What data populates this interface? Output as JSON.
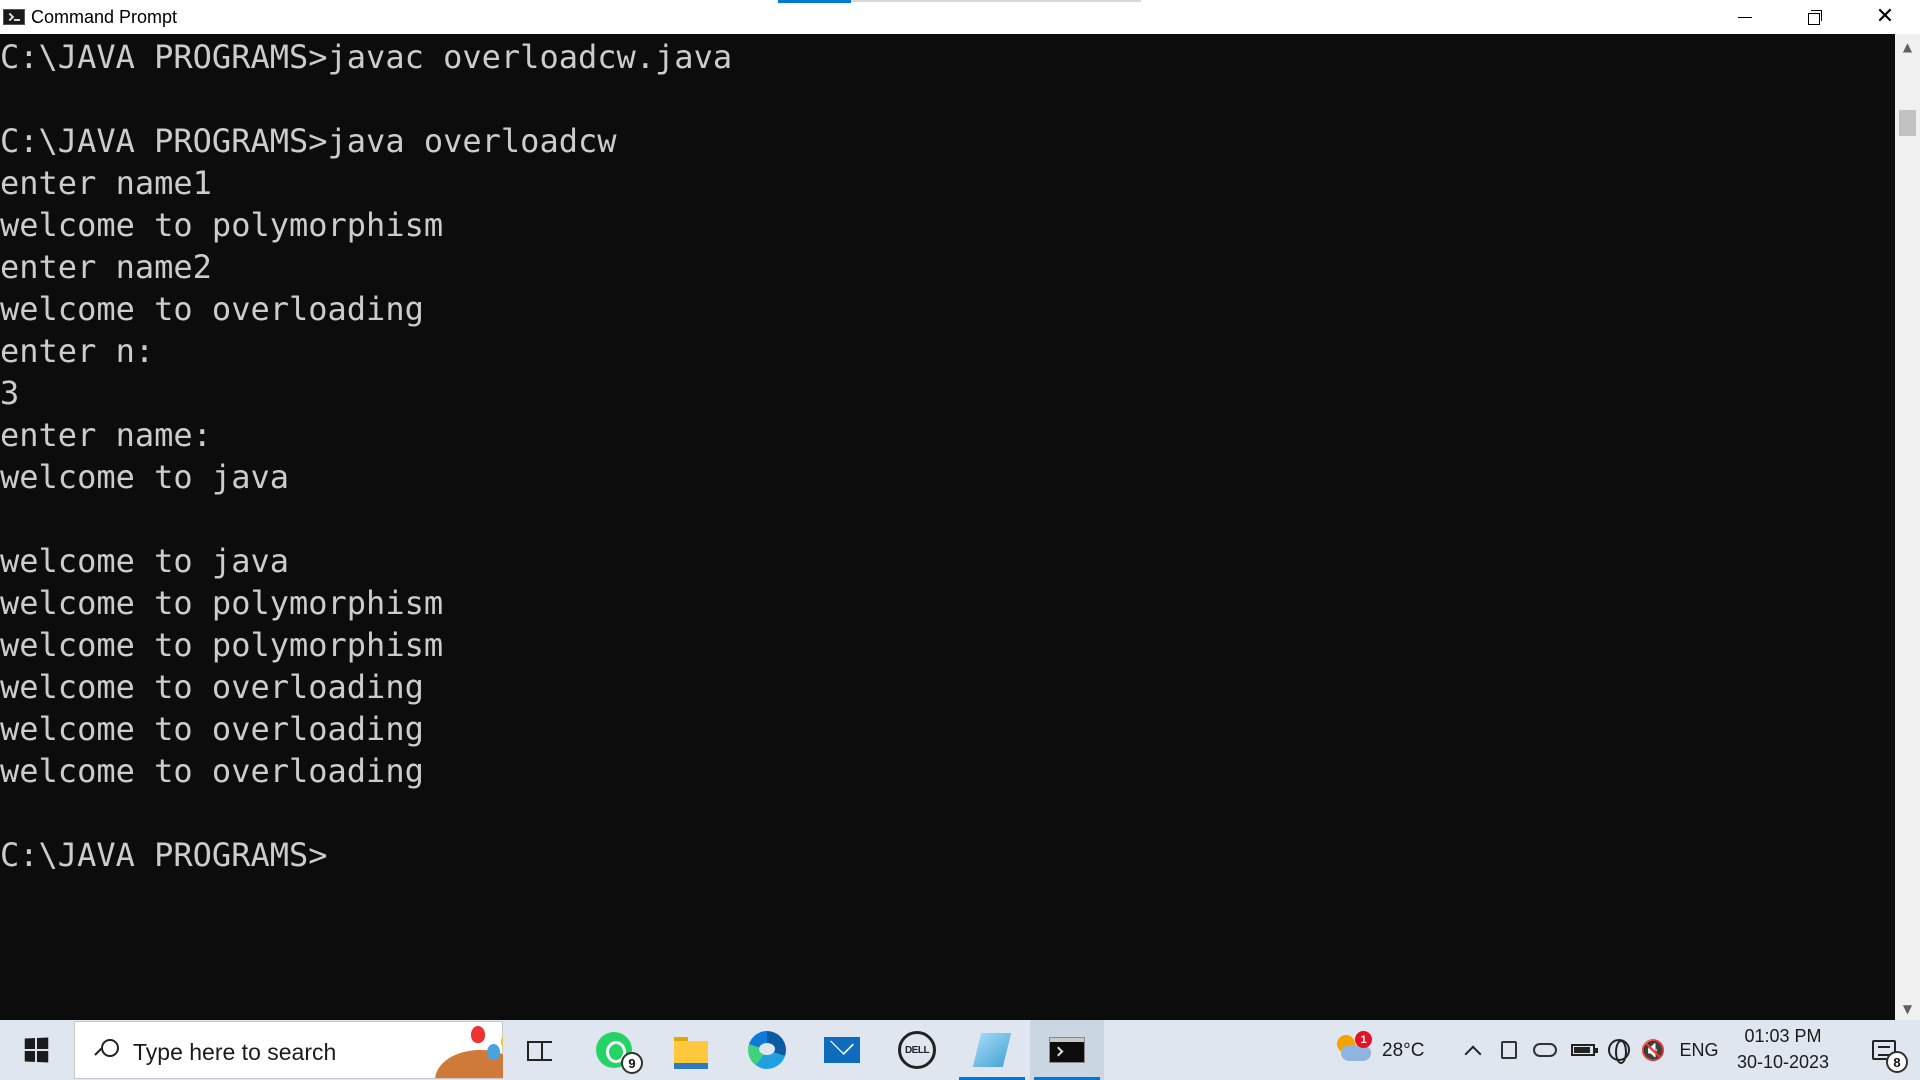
{
  "window": {
    "title": "Command Prompt",
    "controls": {
      "minimize_icon": "minimize-icon",
      "restore_icon": "restore-icon",
      "close_icon": "close-icon"
    }
  },
  "console": {
    "background": "#0c0c0c",
    "foreground": "#cccccc",
    "lines": [
      "C:\\JAVA PROGRAMS>javac overloadcw.java",
      "",
      "C:\\JAVA PROGRAMS>java overloadcw",
      "enter name1",
      "welcome to polymorphism",
      "enter name2",
      "welcome to overloading",
      "enter n:",
      "3",
      "enter name:",
      "welcome to java",
      "",
      "welcome to java",
      "welcome to polymorphism",
      "welcome to polymorphism",
      "welcome to overloading",
      "welcome to overloading",
      "welcome to overloading",
      "",
      "C:\\JAVA PROGRAMS>"
    ]
  },
  "taskbar": {
    "search_placeholder": "Type here to search",
    "apps": [
      {
        "name": "task-view-icon"
      },
      {
        "name": "whatsapp-icon",
        "badge": "9"
      },
      {
        "name": "file-explorer-icon"
      },
      {
        "name": "edge-icon"
      },
      {
        "name": "mail-icon"
      },
      {
        "name": "dell-icon",
        "label": "DELL"
      },
      {
        "name": "notes-app-icon"
      },
      {
        "name": "command-prompt-icon"
      }
    ],
    "weather": {
      "temp": "28°C",
      "badge": "1"
    },
    "language": "ENG",
    "time": "01:03 PM",
    "date": "30-10-2023",
    "notification_count": "8"
  }
}
